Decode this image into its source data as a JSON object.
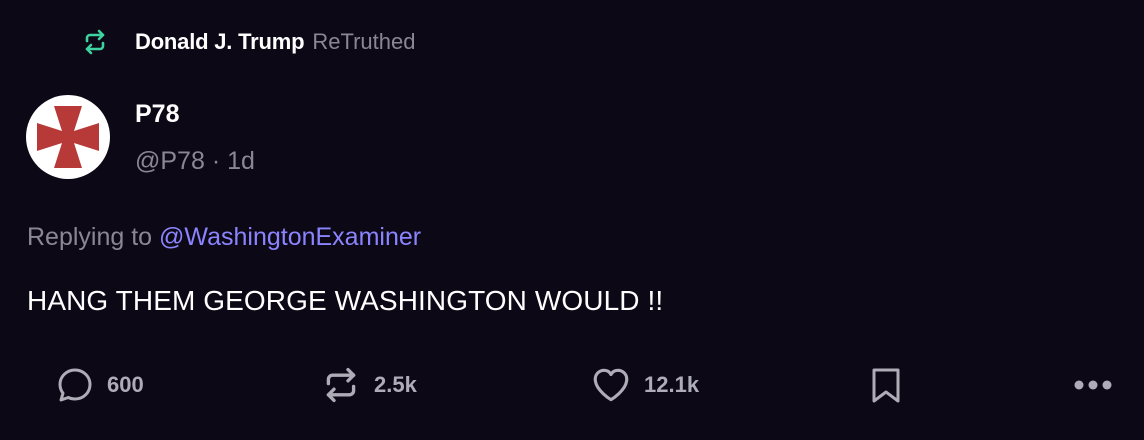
{
  "retruth_header": {
    "icon": "retruth-icon",
    "name": "Donald J. Trump",
    "label": "ReTruthed"
  },
  "author": {
    "avatar_icon": "red-cross-avatar",
    "name": "P78",
    "handle": "@P78",
    "separator": "·",
    "time": "1d"
  },
  "reply_context": {
    "prefix": "Replying to",
    "mention": "@WashingtonExaminer"
  },
  "post": {
    "text": "HANG THEM GEORGE WASHINGTON WOULD !!"
  },
  "actions": {
    "reply_count": "600",
    "retruth_count": "2.5k",
    "like_count": "12.1k"
  },
  "colors": {
    "background": "#0c0816",
    "accent_green": "#3fd3a1",
    "mention": "#8b84ff",
    "muted_text": "#8a8793",
    "avatar_cross": "#b73a39"
  }
}
